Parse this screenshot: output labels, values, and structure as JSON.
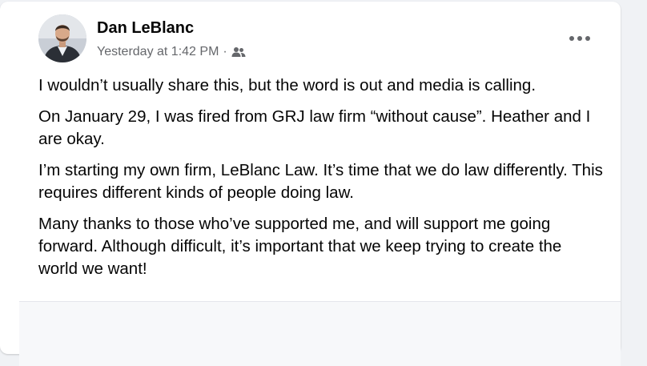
{
  "post": {
    "author": "Dan LeBlanc",
    "timestamp": "Yesterday at 1:42 PM",
    "separator": "·",
    "audience_icon": "friends-icon",
    "more_icon": "more-options-icon",
    "paragraphs": [
      "I wouldn’t usually share this, but the word is out and media is calling.",
      "On January 29, I was fired from GRJ law firm “without cause”. Heather and I are okay.",
      "I’m starting my own firm, LeBlanc Law. It’s time that we do law differently. This requires different kinds of people doing law.",
      "Many thanks to those who’ve supported me, and will support me going forward. Although difficult, it’s important that we keep trying to create the world we want!"
    ]
  },
  "colors": {
    "text_primary": "#050505",
    "text_secondary": "#65676b",
    "card_background": "#ffffff",
    "page_background": "#f0f2f5"
  }
}
